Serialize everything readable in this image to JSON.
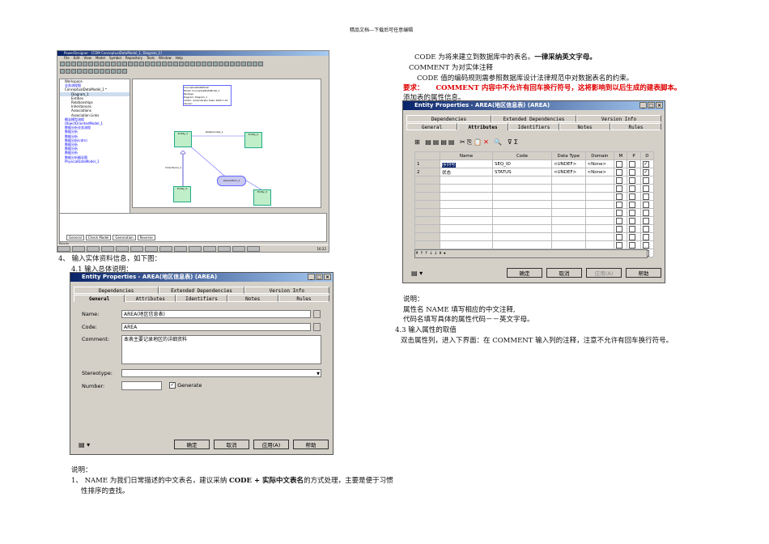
{
  "header": "精品文档---下载后可任意编辑",
  "left": {
    "step4": "4、 输入实体资料信息，如下图：",
    "step41": "4.1 输入总体说明：",
    "note_title": "说明：",
    "note1a": "1、 NAME 为我们日常描述的中文表名，建议采纳 ",
    "note1b": "CODE + 实际中文表名",
    "note1c": "的方式处理，主要是便于习惯",
    "note1d": "性排序的查找。"
  },
  "right": {
    "line1a": "CODE 为将来建立到数据库中的表名。",
    "line1b": "一律采纳英文字母。",
    "line2": "COMMENT 为对实体注释",
    "line3": "CODE 值的编码规则需参照数据库设计法律规范中对数据表名的约束。",
    "req_label": "要求：",
    "req_text": "COMMENT 内容中不允许有回车换行符号，这将影响到以后生成的建表脚本。",
    "line5": "添加表的属性信息。",
    "note_title": "说明：",
    "note1": "属性名 NAME 填写相应的中文注释,",
    "note2": "代码名填写具体的属性代码－－英文字母。",
    "step43": "4.3 输入属性的取值",
    "step43_text": "双击属性列，进入下界面：在 COMMENT 输入列的注释，注意不允许有回车换行符号。"
  },
  "pd": {
    "title": "PowerDesigner - [CDM ConceptualDataModel_1, Diagram_1]",
    "menu": [
      "File",
      "Edit",
      "View",
      "Model",
      "Symbol",
      "Repository",
      "Tools",
      "Window",
      "Help"
    ],
    "tree": [
      "Workspace",
      "业务流程图",
      "ConceptualDataModel_1 *",
      "Diagram_1",
      "Entities",
      "Relationships",
      "Inheritances",
      "Associations",
      "Association Links",
      "概念模型流程",
      "ObjectOrientedModel_1",
      "数据分析业务流程",
      "数据分析",
      "数据分析",
      "数据分析(cdm)",
      "数据分析",
      "数据分析",
      "数据分析",
      "数据分析概念图",
      "PhysicalDataModel_1"
    ],
    "panel_tabs": [
      "Local",
      "Repository"
    ],
    "output_tabs": [
      "General",
      "Check Model",
      "Generation",
      "Reverse"
    ],
    "status": "Ready",
    "clock": "16:22",
    "title_block": [
      "ConceptualDataModel",
      "Model: ConceptualDataModel_1",
      "Package:",
      "Diagram: Diagram_1",
      "Author: Administrator  Date: 2005-7-19",
      "Version:"
    ],
    "entities": [
      "Entity_1",
      "Entity_2",
      "Entity_3",
      "Entity_4"
    ],
    "relationship": "Relationship_1",
    "inheritance": "Inheritance_1",
    "association": "Association_1"
  },
  "dlg1": {
    "title": "Entity Properties - AREA(地区信息表) (AREA)",
    "tabs_back": [
      "Dependencies",
      "Extended Dependencies",
      "Version Info"
    ],
    "tabs_front": [
      "General",
      "Attributes",
      "Identifiers",
      "Notes",
      "Rules"
    ],
    "name_label": "Name:",
    "name_value": "AREA(地区信息表)",
    "code_label": "Code:",
    "code_value": "AREA",
    "comment_label": "Comment:",
    "comment_value": "本表主要记录地区的详细资料",
    "stereotype_label": "Stereotype:",
    "number_label": "Number:",
    "generate_label": "Generate",
    "ok": "确定",
    "cancel": "取消",
    "apply": "应用(A)",
    "help": "帮助"
  },
  "dlg2": {
    "title": "Entity Properties - AREA(地区信息表) (AREA)",
    "tabs_back": [
      "Dependencies",
      "Extended Dependencies",
      "Version Info"
    ],
    "tabs_front": [
      "General",
      "Attributes",
      "Identifiers",
      "Notes",
      "Rules"
    ],
    "columns": [
      "Name",
      "Code",
      "Data Type",
      "Domain",
      "M",
      "P",
      "D"
    ],
    "rows": [
      {
        "num": "1",
        "name": "序列号",
        "code": "SEQ_ID",
        "type": "<UNDEF>",
        "domain": "<None>",
        "m": false,
        "p": false,
        "d": true
      },
      {
        "num": "2",
        "name": "状态",
        "code": "STATUS",
        "type": "<UNDEF>",
        "domain": "<None>",
        "m": false,
        "p": false,
        "d": true
      }
    ],
    "ok": "确定",
    "cancel": "取消",
    "apply": "应用(A)",
    "help": "帮助"
  }
}
